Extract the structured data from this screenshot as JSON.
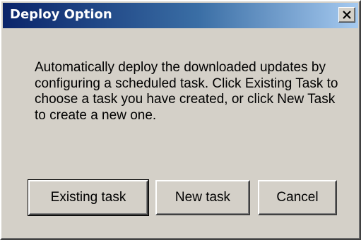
{
  "window": {
    "title": "Deploy Option",
    "close_icon": "close-x-icon"
  },
  "message": "Automatically deploy the downloaded updates by configuring a scheduled task. Click Existing Task to choose a task you have created, or click New Task to create a new one.",
  "buttons": {
    "existing_label": "Existing task",
    "new_label": "New task",
    "cancel_label": "Cancel"
  },
  "colors": {
    "title_bar_start": "#0a246a",
    "title_bar_end": "#a6caf0",
    "face": "#d4d0c8"
  }
}
